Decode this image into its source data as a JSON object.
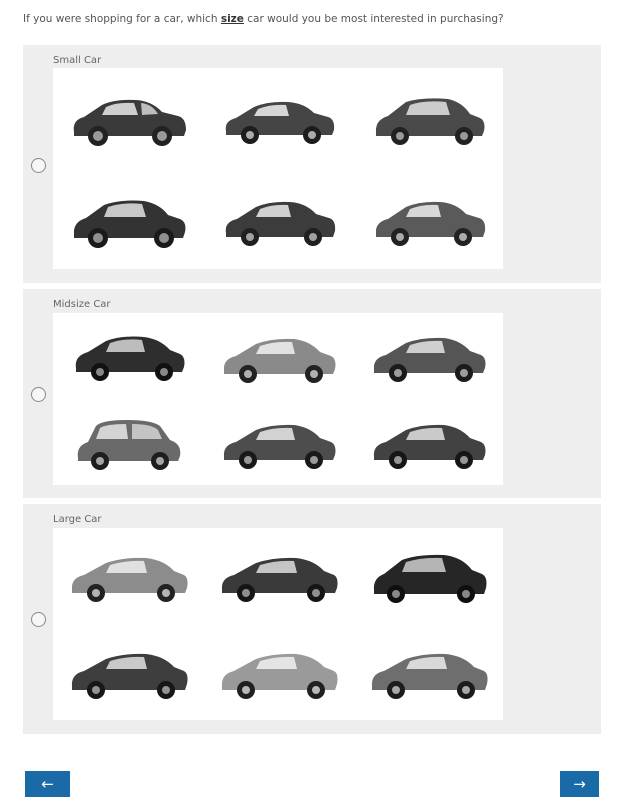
{
  "question": {
    "prefix": "If you were shopping for a car, which ",
    "emphasis": "size",
    "suffix": " car would you be most interested in purchasing?"
  },
  "options": [
    {
      "label": "Small Car"
    },
    {
      "label": "Midsize Car"
    },
    {
      "label": "Large Car"
    }
  ],
  "navigation": {
    "back_label": "←",
    "next_label": "→"
  },
  "colors": {
    "panel_bg": "#eeeeee",
    "button_bg": "#1a6aa8"
  },
  "icons": {
    "car_image": "car-photo-icon"
  }
}
